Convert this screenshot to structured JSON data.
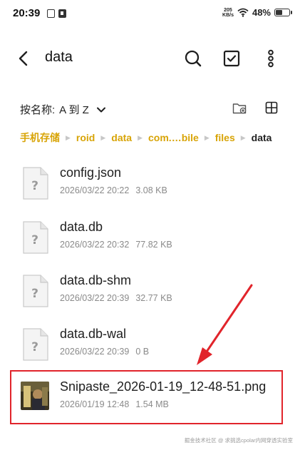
{
  "status_bar": {
    "time": "20:39",
    "net_speed_value": "205",
    "net_speed_unit": "KB/s",
    "battery": "48%"
  },
  "toolbar": {
    "title": "data"
  },
  "sort": {
    "label": "按名称:",
    "value": "A 到 Z"
  },
  "breadcrumb": [
    "手机存储",
    "roid",
    "data",
    "com.…bile",
    "files",
    "data"
  ],
  "files": [
    {
      "name": "config.json",
      "date": "2026/03/22 20:22",
      "size": "3.08 KB"
    },
    {
      "name": "data.db",
      "date": "2026/03/22 20:32",
      "size": "77.82 KB"
    },
    {
      "name": "data.db-shm",
      "date": "2026/03/22 20:39",
      "size": "32.77 KB"
    },
    {
      "name": "data.db-wal",
      "date": "2026/03/22 20:39",
      "size": "0 B"
    },
    {
      "name": "Snipaste_2026-01-19_12-48-51.png",
      "date": "2026/01/19 12:48",
      "size": "1.54 MB"
    }
  ],
  "colors": {
    "breadcrumb": "#d8a407",
    "highlight": "#e1242b"
  },
  "watermark": "掘金技术社区 @ 求挑选cpolar内网穿透实验室"
}
